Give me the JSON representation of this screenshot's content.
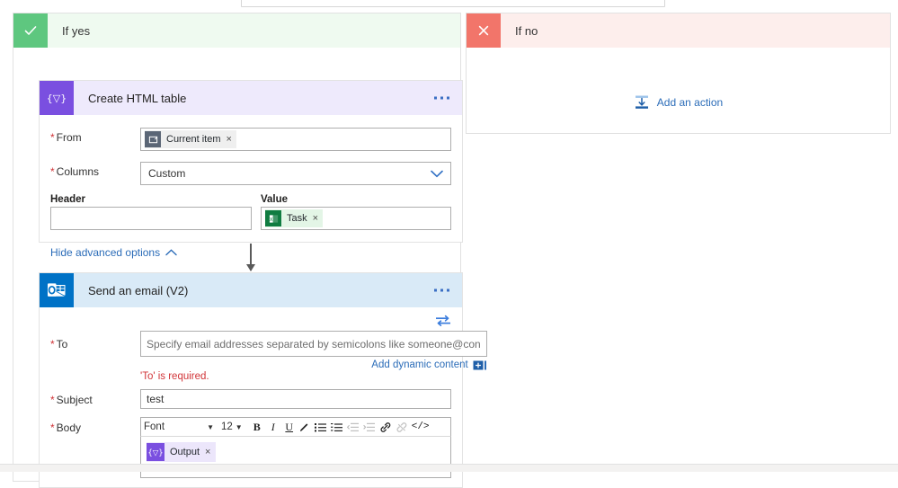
{
  "branches": {
    "yes": {
      "title": "If yes",
      "icon": "check-icon",
      "color": "#5ec77f",
      "header_bg": "#effaf0"
    },
    "no": {
      "title": "If no",
      "icon": "close-icon",
      "color": "#f2756a",
      "header_bg": "#fdeeec",
      "add_action_label": "Add an action",
      "add_action_icon": "insert-action-icon"
    }
  },
  "create_html_table": {
    "title": "Create HTML table",
    "icon": "data-operations-icon",
    "icon_glyph": "{▽}",
    "menu_icon": "ellipsis-icon",
    "fields": {
      "from_label": "From",
      "from_token": {
        "text": "Current item",
        "icon": "current-item-icon",
        "remove": "×"
      },
      "columns_label": "Columns",
      "columns_value": "Custom",
      "columns_chevron": "chevron-down-icon",
      "header_label": "Header",
      "header_value": "",
      "value_label": "Value",
      "value_token": {
        "text": "Task",
        "icon": "excel-icon",
        "remove": "×"
      }
    },
    "advanced_link": "Hide advanced options",
    "advanced_chevron": "chevron-up-icon"
  },
  "send_email": {
    "title": "Send an email (V2)",
    "icon": "outlook-icon",
    "menu_icon": "ellipsis-icon",
    "swap_icon": "switch-inputs-icon",
    "to_label": "To",
    "to_placeholder": "Specify email addresses separated by semicolons like someone@con",
    "to_value": "",
    "add_dynamic_content": "Add dynamic content",
    "add_dynamic_icon": "dynamic-content-icon",
    "to_error": "'To' is required.",
    "subject_label": "Subject",
    "subject_value": "test",
    "body_label": "Body",
    "toolbar": {
      "font_name": "Font",
      "font_size": "12",
      "bold": "B",
      "italic": "I",
      "underline": "U",
      "highlight_icon": "pen-icon",
      "bulleted_list_icon": "bulleted-list-icon",
      "numbered_list_icon": "numbered-list-icon",
      "outdent_icon": "decrease-indent-icon",
      "indent_icon": "increase-indent-icon",
      "link_icon": "link-icon",
      "unlink_icon": "unlink-icon",
      "code_view": "</>"
    },
    "body_token": {
      "text": "Output",
      "icon": "data-operations-icon",
      "icon_glyph": "{▽}",
      "remove": "×"
    }
  },
  "colors": {
    "accent_blue": "#2b6cb8",
    "required_red": "#d13438",
    "purple": "#7a4fe0",
    "outlook_blue": "#0072c6",
    "excel_green": "#107c41"
  }
}
